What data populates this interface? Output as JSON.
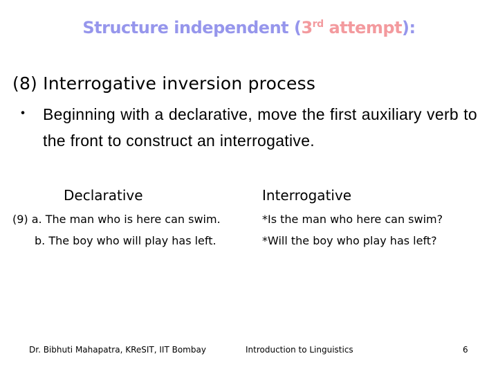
{
  "title": {
    "part1": "Structure independent (",
    "superscript_base": "3",
    "superscript": "rd",
    "part2": " attempt",
    "part3": "):",
    "colors": {
      "primary": "#9696ec",
      "accent": "#f39a9e"
    }
  },
  "heading": "(8) Interrogative inversion process",
  "bullet": {
    "marker": "・",
    "text": "Beginning with a declarative, move the first auxiliary verb to the front to construct an interrogative."
  },
  "examples": {
    "columns": {
      "declarative": "Declarative",
      "interrogative": "Interrogative"
    },
    "rows": [
      {
        "declarative": "(9) a. The man who is here can swim.",
        "interrogative": "*Is the man who here can  swim?"
      },
      {
        "declarative": "b. The boy who will play has left.",
        "interrogative": "*Will the boy who play has left?"
      }
    ]
  },
  "footer": {
    "author": "Dr. Bibhuti Mahapatra,  KReSIT, IIT Bombay",
    "course": "Introduction to Linguistics",
    "page_number": "6"
  }
}
